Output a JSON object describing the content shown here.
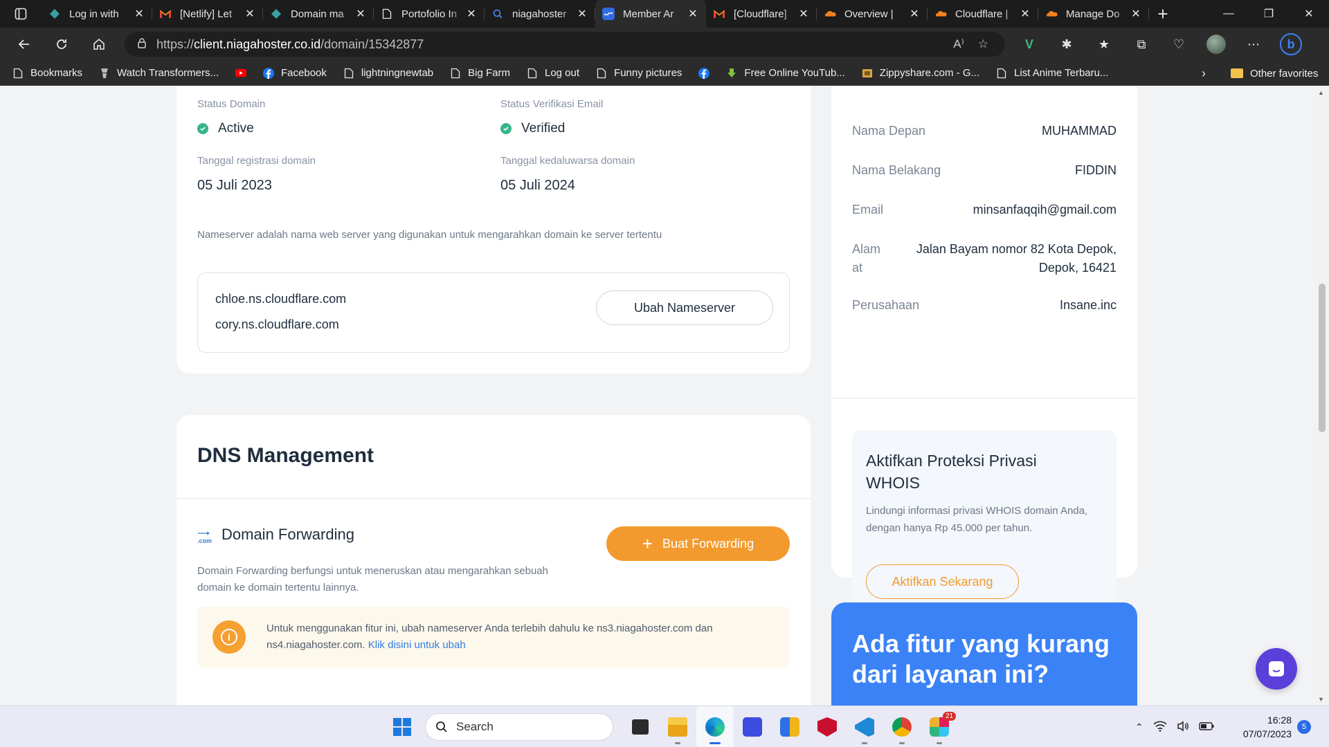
{
  "browser": {
    "tabs": [
      {
        "title": "Log in with",
        "active": false,
        "icon": "netlify-icon"
      },
      {
        "title": "[Netlify] Let",
        "active": false,
        "icon": "gmail-icon"
      },
      {
        "title": "Domain ma",
        "active": false,
        "icon": "netlify-icon"
      },
      {
        "title": "Portofolio In",
        "active": false,
        "icon": "page-icon"
      },
      {
        "title": "niagahoster",
        "active": false,
        "icon": "search-icon"
      },
      {
        "title": "Member Ar",
        "active": true,
        "icon": "niagahoster-icon"
      },
      {
        "title": "[Cloudflare]",
        "active": false,
        "icon": "gmail-icon"
      },
      {
        "title": "Overview | ",
        "active": false,
        "icon": "cloudflare-icon"
      },
      {
        "title": "Cloudflare |",
        "active": false,
        "icon": "cloudflare-icon"
      },
      {
        "title": "Manage Do",
        "active": false,
        "icon": "cloudflare-icon"
      }
    ],
    "url_scheme": "https://",
    "url_host": "client.niagahoster.co.id",
    "url_path": "/domain/15342877",
    "bookmarks": [
      {
        "label": "Bookmarks",
        "icon": "page-icon"
      },
      {
        "label": "Watch Transformers...",
        "icon": "transformers-icon"
      },
      {
        "label": "",
        "icon": "youtube-icon"
      },
      {
        "label": "Facebook",
        "icon": "facebook-icon"
      },
      {
        "label": "lightningnewtab",
        "icon": "page-icon"
      },
      {
        "label": "Big Farm",
        "icon": "page-icon"
      },
      {
        "label": "Log out",
        "icon": "page-icon"
      },
      {
        "label": "Funny pictures",
        "icon": "page-icon"
      },
      {
        "label": "",
        "icon": "facebook-icon"
      },
      {
        "label": "Free Online YouTub...",
        "icon": "download-icon"
      },
      {
        "label": "Zippyshare.com - G...",
        "icon": "zippyshare-icon"
      },
      {
        "label": "List Anime Terbaru...",
        "icon": "page-icon"
      }
    ],
    "other_favorites": "Other favorites"
  },
  "domain_info": {
    "status_label": "Status Domain",
    "status_value": "Active",
    "email_verif_label": "Status Verifikasi Email",
    "email_verif_value": "Verified",
    "reg_label": "Tanggal registrasi domain",
    "reg_value": "05 Juli 2023",
    "exp_label": "Tanggal kedaluwarsa domain",
    "exp_value": "05 Juli 2024",
    "ns_note": "Nameserver adalah nama web server yang digunakan untuk mengarahkan domain ke server tertentu",
    "nameservers": [
      "chloe.ns.cloudflare.com",
      "cory.ns.cloudflare.com"
    ],
    "change_ns_button": "Ubah Nameserver"
  },
  "dns": {
    "title": "DNS Management",
    "forwarding_title": "Domain Forwarding",
    "forwarding_icon_text": ".com",
    "forwarding_desc": "Domain Forwarding berfungsi untuk meneruskan atau mengarahkan sebuah domain ke domain tertentu lainnya.",
    "create_button": "Buat Forwarding",
    "warning_text": "Untuk menggunakan fitur ini, ubah nameserver Anda terlebih dahulu ke ns3.niagahoster.com dan ns4.niagahoster.com.",
    "warning_link": "Klik disini untuk ubah"
  },
  "contact": {
    "rows": [
      {
        "key": "Nama Depan",
        "value": "MUHAMMAD"
      },
      {
        "key": "Nama Belakang",
        "value": "FIDDIN"
      },
      {
        "key": "Email",
        "value": "minsanfaqqih@gmail.com"
      },
      {
        "key": "Alam\nat",
        "value": "Jalan Bayam nomor 82 Kota Depok,\nDepok, 16421"
      },
      {
        "key": "Perusahaan",
        "value": "Insane.inc"
      }
    ]
  },
  "privacy": {
    "title": "Aktifkan Proteksi Privasi WHOIS",
    "desc": "Lindungi informasi privasi WHOIS domain Anda, dengan hanya Rp 45.000 per tahun.",
    "button": "Aktifkan Sekarang"
  },
  "feedback": {
    "title": "Ada fitur yang kurang dari layanan ini?"
  },
  "taskbar": {
    "search_placeholder": "Search",
    "mail_badge": "21",
    "time": "16:28",
    "date": "07/07/2023",
    "notifications": "5"
  },
  "colors": {
    "accent_orange": "#f39a2e",
    "success_green": "#37b48c",
    "link_blue": "#2f7be5",
    "promo_blue": "#3b82f6",
    "chat_purple": "#5b3fd9"
  }
}
